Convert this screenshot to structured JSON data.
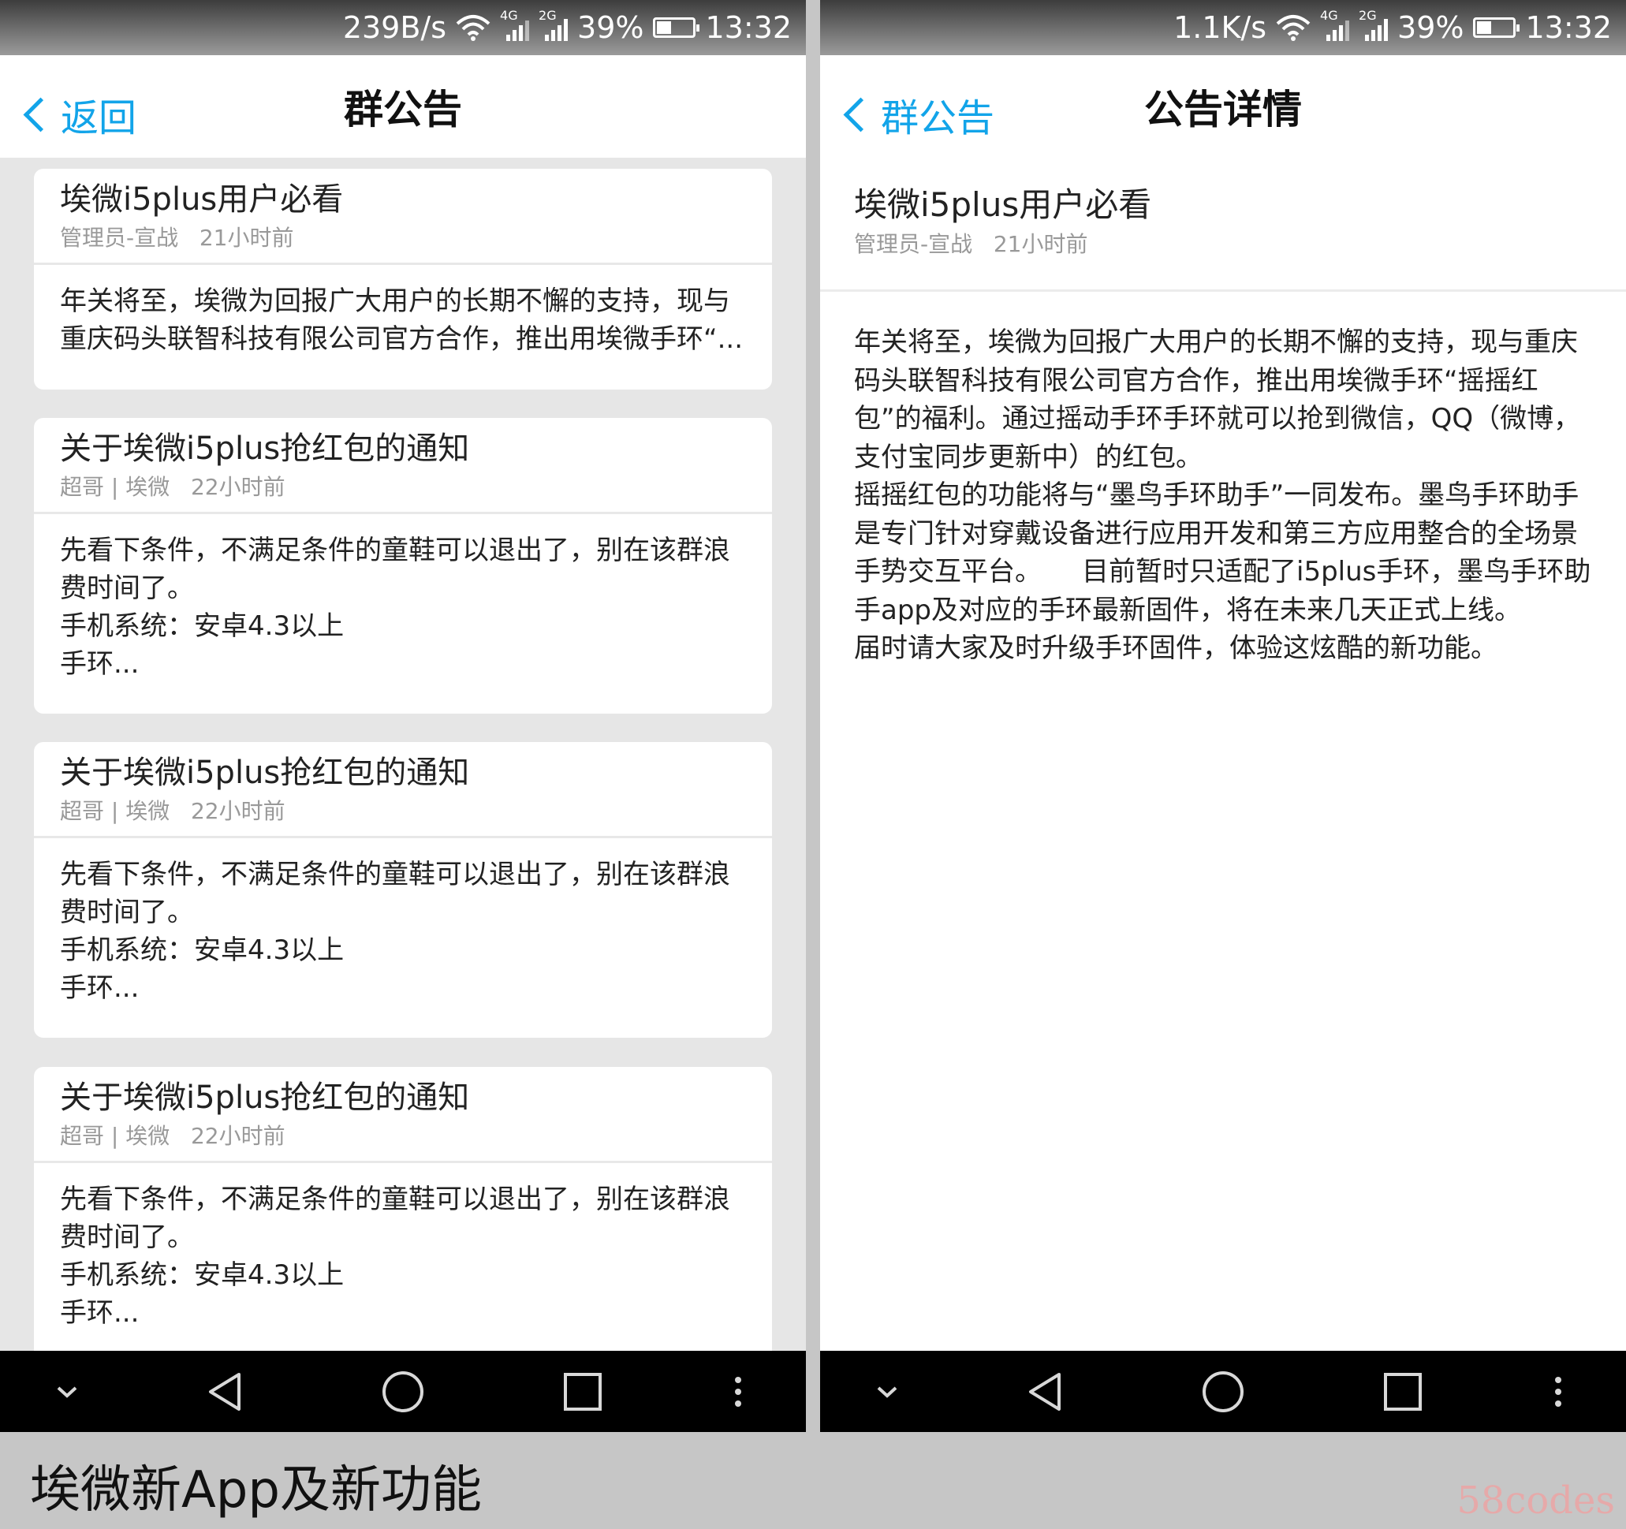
{
  "left": {
    "status": {
      "speed": "239B/s",
      "net1": "4G",
      "net2": "2G",
      "battery_pct": "39%",
      "battery_level": 0.39,
      "time": "13:32"
    },
    "header": {
      "back_label": "返回",
      "title": "群公告"
    },
    "cards": [
      {
        "title": "埃微i5plus用户必看",
        "author": "管理员-宣战",
        "time": "21小时前",
        "body": [
          "年关将至，埃微为回报广大用户的长期不懈的支持，现与",
          "重庆码头联智科技有限公司官方合作，推出用埃微手环“..."
        ]
      },
      {
        "title": "关于埃微i5plus抢红包的通知",
        "author": "超哥 | 埃微",
        "time": "22小时前",
        "body": [
          "先看下条件，不满足条件的童鞋可以退出了，别在该群浪",
          "费时间了。",
          "手机系统：安卓4.3以上",
          "手环..."
        ]
      },
      {
        "title": "关于埃微i5plus抢红包的通知",
        "author": "超哥 | 埃微",
        "time": "22小时前",
        "body": [
          "先看下条件，不满足条件的童鞋可以退出了，别在该群浪",
          "费时间了。",
          "手机系统：安卓4.3以上",
          "手环..."
        ]
      },
      {
        "title": "关于埃微i5plus抢红包的通知",
        "author": "超哥 | 埃微",
        "time": "22小时前",
        "body": [
          "先看下条件，不满足条件的童鞋可以退出了，别在该群浪",
          "费时间了。",
          "手机系统：安卓4.3以上",
          "手环..."
        ]
      }
    ]
  },
  "right": {
    "status": {
      "speed": "1.1K/s",
      "net1": "4G",
      "net2": "2G",
      "battery_pct": "39%",
      "battery_level": 0.39,
      "time": "13:32"
    },
    "header": {
      "back_label": "群公告",
      "title": "公告详情"
    },
    "detail": {
      "title": "埃微i5plus用户必看",
      "author": "管理员-宣战",
      "time": "21小时前",
      "lines": [
        "年关将至，埃微为回报广大用户的长期不懈的支持，现与重庆",
        "码头联智科技有限公司官方合作，推出用埃微手环“摇摇红",
        "包”的福利。通过摇动手环手环就可以抢到微信，QQ（微博，",
        "支付宝同步更新中）的红包。",
        "摇摇红包的功能将与“墨鸟手环助手”一同发布。墨鸟手环助手",
        "是专门针对穿戴设备进行应用开发和第三方应用整合的全场景",
        "手势交互平台。　　目前暂时只适配了i5plus手环，墨鸟手环助",
        "手app及对应的手环最新固件，将在未来几天正式上线。",
        "届时请大家及时升级手环固件，体验这炫酷的新功能。"
      ]
    }
  },
  "caption": "埃微新App及新功能",
  "watermark": "58codes",
  "icons": {
    "wifi": "wifi-icon",
    "signal": "signal-icon",
    "battery": "battery-icon",
    "back": "chevron-left-icon",
    "nav": [
      "chevron-down-icon",
      "back-triangle-icon",
      "home-circle-icon",
      "recent-square-icon",
      "more-dots-icon"
    ]
  },
  "colors": {
    "accent": "#12a4e9",
    "list_bg": "#e6e6e6",
    "nav_bg": "#000000",
    "meta": "#999999"
  }
}
